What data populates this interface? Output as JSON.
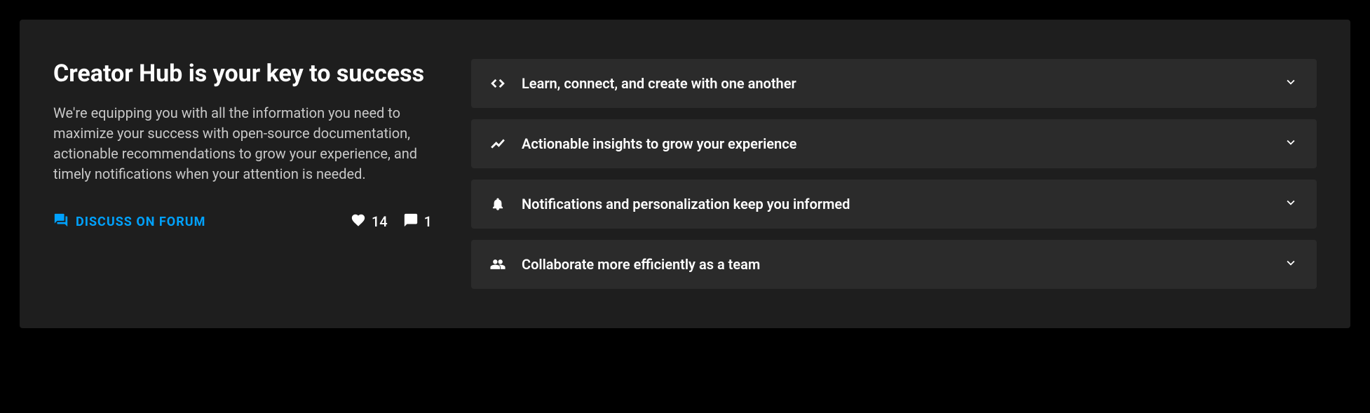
{
  "left": {
    "title": "Creator Hub is your key to success",
    "description": "We're equipping you with all the information you need to maximize your success with open-source documentation, actionable recommendations to grow your experience, and timely notifications when your attention is needed.",
    "forum_link_label": "DISCUSS ON FORUM",
    "likes_count": "14",
    "comments_count": "1"
  },
  "accordion": {
    "items": [
      {
        "icon": "code-icon",
        "label": "Learn, connect, and create with one another"
      },
      {
        "icon": "analytics-icon",
        "label": "Actionable insights to grow your experience"
      },
      {
        "icon": "bell-icon",
        "label": "Notifications and personalization keep you informed"
      },
      {
        "icon": "group-icon",
        "label": "Collaborate more efficiently as a team"
      }
    ]
  }
}
